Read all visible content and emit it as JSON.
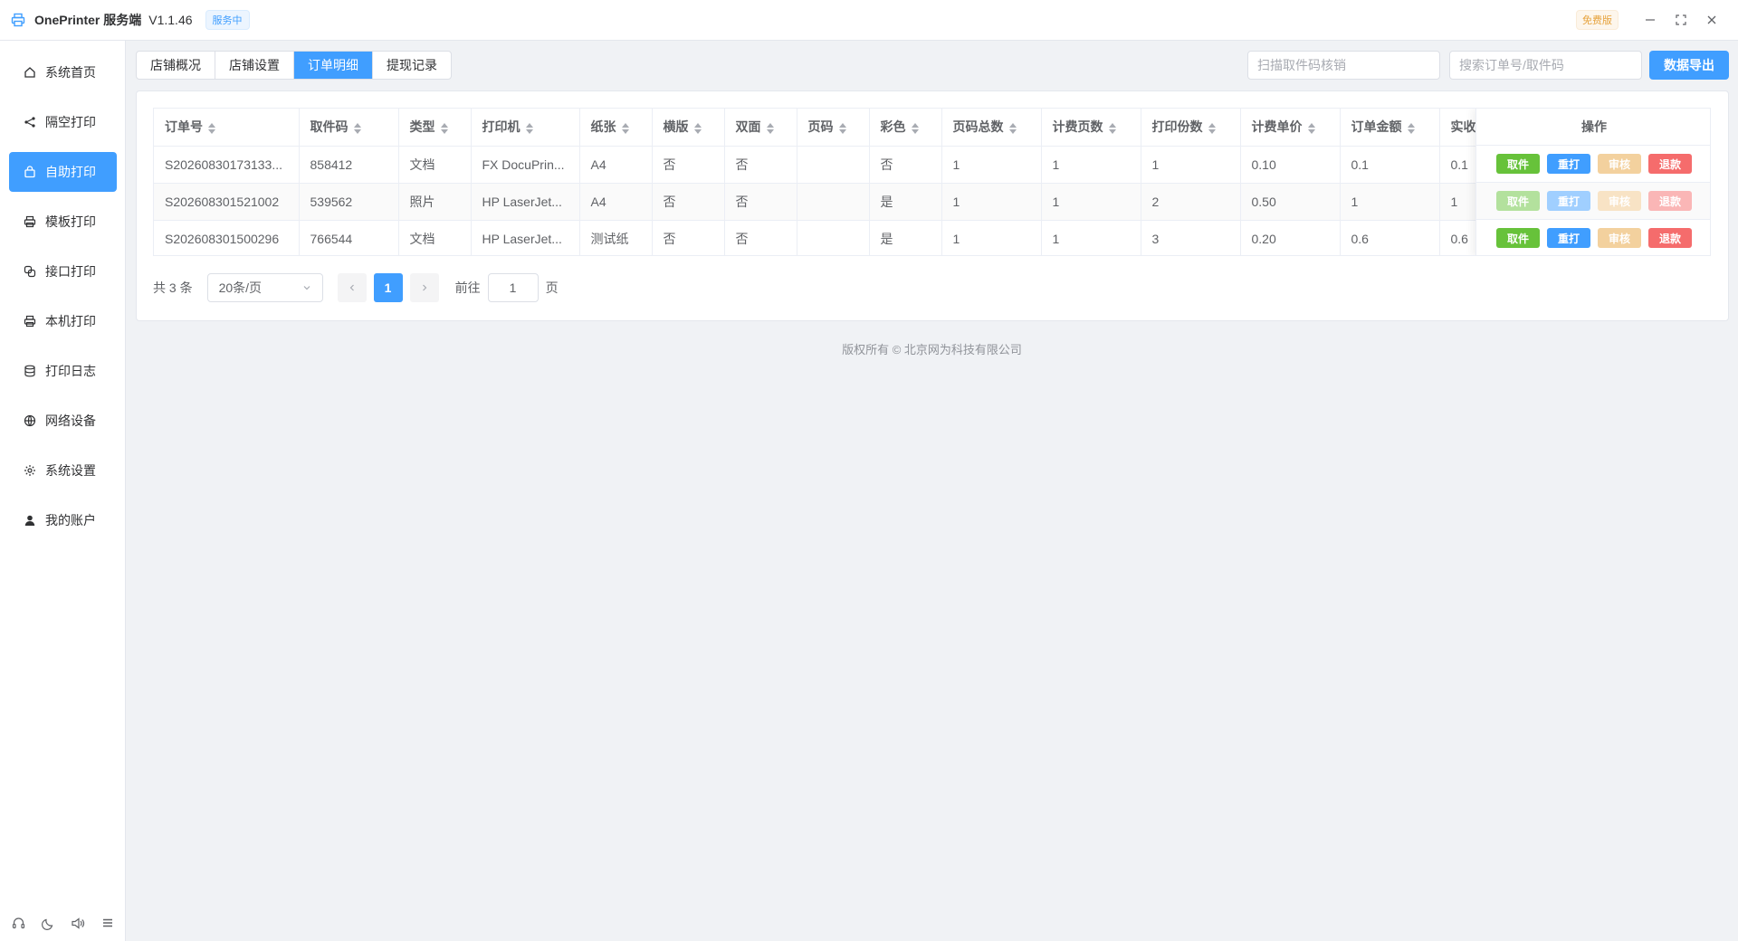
{
  "app": {
    "name": "OnePrinter 服务端",
    "version": "V1.1.46",
    "status_badge": "服务中",
    "plan_badge": "免费版"
  },
  "sidebar": {
    "items": [
      {
        "label": "系统首页",
        "icon": "home-icon"
      },
      {
        "label": "隔空打印",
        "icon": "share-icon"
      },
      {
        "label": "自助打印",
        "icon": "bag-icon",
        "active": true
      },
      {
        "label": "模板打印",
        "icon": "printer-icon"
      },
      {
        "label": "接口打印",
        "icon": "link-icon"
      },
      {
        "label": "本机打印",
        "icon": "printer-icon"
      },
      {
        "label": "打印日志",
        "icon": "database-icon"
      },
      {
        "label": "网络设备",
        "icon": "globe-icon"
      },
      {
        "label": "系统设置",
        "icon": "gear-icon"
      },
      {
        "label": "我的账户",
        "icon": "user-icon"
      }
    ]
  },
  "tabs": [
    "店铺概况",
    "店铺设置",
    "订单明细",
    "提现记录"
  ],
  "active_tab": "订单明细",
  "toolbar": {
    "scan_placeholder": "扫描取件码核销",
    "search_placeholder": "搜索订单号/取件码",
    "export_label": "数据导出"
  },
  "table": {
    "columns": [
      "订单号",
      "取件码",
      "类型",
      "打印机",
      "纸张",
      "横版",
      "双面",
      "页码",
      "彩色",
      "页码总数",
      "计费页数",
      "打印份数",
      "计费单价",
      "订单金额",
      "实收"
    ],
    "operation_header": "操作",
    "rows": [
      {
        "order": "S20260830173133...",
        "code": "858412",
        "type": "文档",
        "printer": "FX DocuPrin...",
        "paper": "A4",
        "landscape": "否",
        "duplex": "否",
        "pages": "",
        "color": "否",
        "total_pages": "1",
        "billed_pages": "1",
        "copies": "1",
        "unit_price": "0.10",
        "amount": "0.1",
        "received": "0.1",
        "ops_enabled": true
      },
      {
        "order": "S202608301521002",
        "code": "539562",
        "type": "照片",
        "printer": "HP LaserJet...",
        "paper": "A4",
        "landscape": "否",
        "duplex": "否",
        "pages": "",
        "color": "是",
        "total_pages": "1",
        "billed_pages": "1",
        "copies": "2",
        "unit_price": "0.50",
        "amount": "1",
        "received": "1",
        "ops_enabled": false
      },
      {
        "order": "S202608301500296",
        "code": "766544",
        "type": "文档",
        "printer": "HP LaserJet...",
        "paper": "测试纸",
        "landscape": "否",
        "duplex": "否",
        "pages": "",
        "color": "是",
        "total_pages": "1",
        "billed_pages": "1",
        "copies": "3",
        "unit_price": "0.20",
        "amount": "0.6",
        "received": "0.6",
        "ops_enabled": true
      }
    ],
    "operations": [
      "取件",
      "重打",
      "审核",
      "退款"
    ]
  },
  "pagination": {
    "total": "共 3 条",
    "page_size": "20条/页",
    "current_page": "1",
    "goto_label": "前往",
    "goto_value": "1",
    "goto_suffix": "页"
  },
  "footer": "版权所有 ©  北京网为科技有限公司",
  "colors": {
    "accent": "#409eff",
    "success": "#67c23a",
    "warning": "#f3d19e",
    "danger": "#f56c6c"
  }
}
